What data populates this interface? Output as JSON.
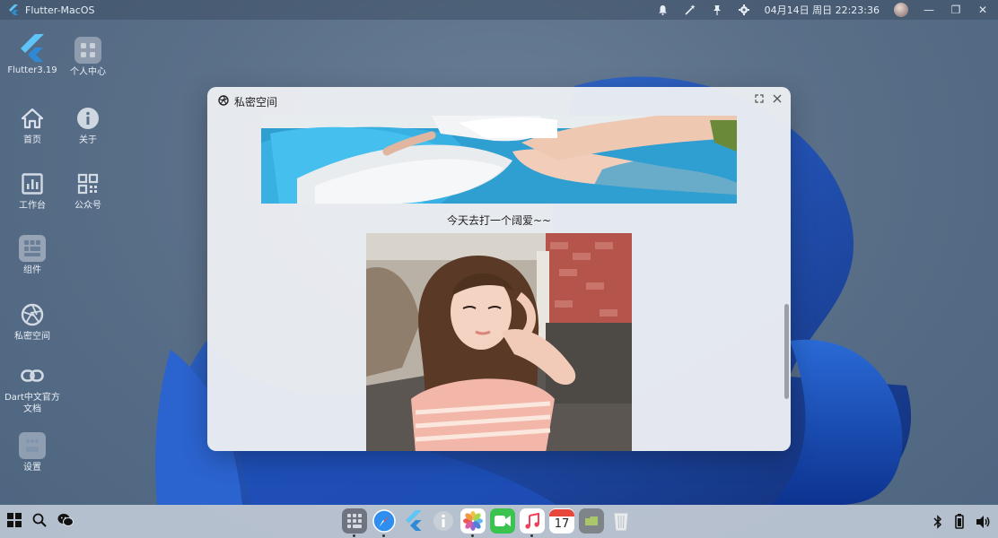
{
  "topbar": {
    "app_title": "Flutter-MacOS",
    "datetime": "04月14日 周日 22:23:36",
    "icons": [
      "bell-icon",
      "magic-wand-icon",
      "pin-icon",
      "gear-icon"
    ]
  },
  "desktop": {
    "items": [
      {
        "label": "Flutter3.19",
        "icon": "flutter-logo-icon"
      },
      {
        "label": "个人中心",
        "icon": "app-grid-icon"
      },
      {
        "label": "首页",
        "icon": "home-icon"
      },
      {
        "label": "关于",
        "icon": "info-icon"
      },
      {
        "label": "工作台",
        "icon": "chart-icon"
      },
      {
        "label": "公众号",
        "icon": "qrcode-icon"
      },
      {
        "label": "组件",
        "icon": "widget-grid-icon"
      },
      {
        "label": "私密空间",
        "icon": "aperture-icon"
      },
      {
        "label": "Dart中文官方文档",
        "icon": "link-icon"
      },
      {
        "label": "设置",
        "icon": "settings-grid-icon"
      }
    ]
  },
  "window": {
    "title": "私密空间",
    "caption": "今天去打一个阔爱~~",
    "colors": {
      "background": "#eceef2",
      "scrollbar": "#9aa0a6"
    }
  },
  "dock": {
    "left_icons": [
      "windows-start-icon",
      "search-icon",
      "wechat-icon"
    ],
    "center_icons": [
      "launchpad-icon",
      "safari-icon",
      "flutter-icon",
      "info-icon",
      "photos-icon",
      "facetime-icon",
      "music-icon",
      "calendar-icon",
      "folder-icon",
      "trash-icon"
    ],
    "calendar_day": "17",
    "right_icons": [
      "bluetooth-icon",
      "battery-icon",
      "volume-icon"
    ]
  }
}
